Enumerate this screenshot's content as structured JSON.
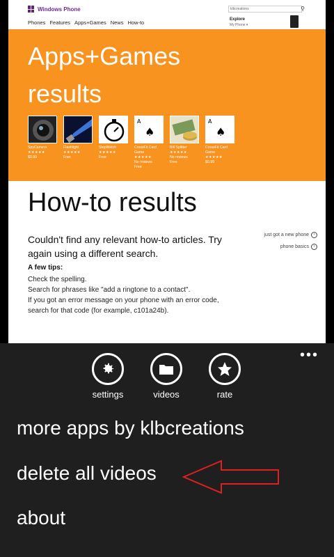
{
  "site": {
    "logo": "Windows Phone",
    "nav": [
      "Phones",
      "Features",
      "Apps+Games",
      "News",
      "How-to"
    ],
    "search_value": "klbcreations",
    "explore": "Explore",
    "explore_sub": "My Phone ▾"
  },
  "apps_section": {
    "title": "Apps+Games results",
    "apps": [
      {
        "name": "SpyCamera",
        "sub": "",
        "stars": "★★★★★",
        "price": "$0.99"
      },
      {
        "name": "Flashlight",
        "sub": "",
        "stars": "★★★★★",
        "price": "Free"
      },
      {
        "name": "StopWatch",
        "sub": "",
        "stars": "★★★★★",
        "price": "Free"
      },
      {
        "name": "CrossFit Card Game",
        "sub": "No reviews",
        "stars": "★★★★★",
        "price": "Free"
      },
      {
        "name": "Bill Splitter",
        "sub": "No reviews",
        "stars": "★★★★★",
        "price": "Free"
      },
      {
        "name": "CrossFit Card Game",
        "sub": "",
        "stars": "★★★★★",
        "price": "$0.99"
      }
    ]
  },
  "howto": {
    "title": "How-to results",
    "not_found": "Couldn't find any relevant how-to articles. Try again using a different search.",
    "tips_head": "A few tips:",
    "tips": [
      "Check the spelling.",
      "Search for phrases like \"add a ringtone to a contact\".",
      "If you got an error message on your phone with an error code, search for that code (for example, c101a24b)."
    ],
    "side_links": [
      "just got a new phone",
      "phone basics"
    ]
  },
  "appbar": {
    "ellipsis": "•••",
    "buttons": [
      {
        "label": "settings",
        "icon": "gear-icon"
      },
      {
        "label": "videos",
        "icon": "folder-icon"
      },
      {
        "label": "rate",
        "icon": "star-icon"
      }
    ],
    "menu": [
      "more apps by klbcreations",
      "delete all videos",
      "about"
    ]
  }
}
